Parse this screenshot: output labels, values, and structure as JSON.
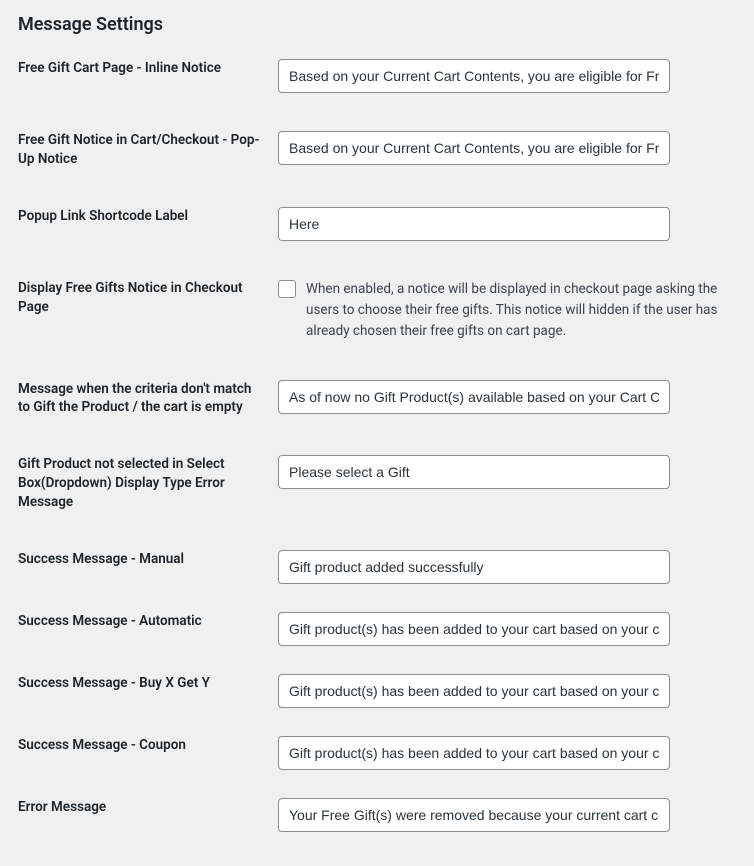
{
  "heading": "Message Settings",
  "rows": {
    "inline_notice": {
      "label": "Free Gift Cart Page - Inline Notice",
      "value": "Based on your Current Cart Contents, you are eligible for Free"
    },
    "popup_notice": {
      "label": "Free Gift Notice in Cart/Checkout - Pop-Up Notice",
      "value": "Based on your Current Cart Contents, you are eligible for Free"
    },
    "popup_link_label": {
      "label": "Popup Link Shortcode Label",
      "value": "Here"
    },
    "display_checkout_notice": {
      "label": "Display Free Gifts Notice in Checkout Page",
      "checked": false,
      "description": "When enabled, a notice will be displayed in checkout page asking the users to choose their free gifts. This notice will hidden if the user has already chosen their free gifts on cart page."
    },
    "no_match_msg": {
      "label": "Message when the criteria don't match to Gift the Product / the cart is empty",
      "value": "As of now no Gift Product(s) available based on your Cart Con"
    },
    "dropdown_error": {
      "label": "Gift Product not selected in Select Box(Dropdown) Display Type Error Message",
      "value": "Please select a Gift"
    },
    "success_manual": {
      "label": "Success Message - Manual",
      "value": "Gift product added successfully"
    },
    "success_auto": {
      "label": "Success Message - Automatic",
      "value": "Gift product(s) has been added to your cart based on your car"
    },
    "success_bogo": {
      "label": "Success Message - Buy X Get Y",
      "value": "Gift product(s) has been added to your cart based on your car"
    },
    "success_coupon": {
      "label": "Success Message - Coupon",
      "value": "Gift product(s) has been added to your cart based on your car"
    },
    "error_msg": {
      "label": "Error Message",
      "value": "Your Free Gift(s) were removed because your current cart cont"
    }
  }
}
